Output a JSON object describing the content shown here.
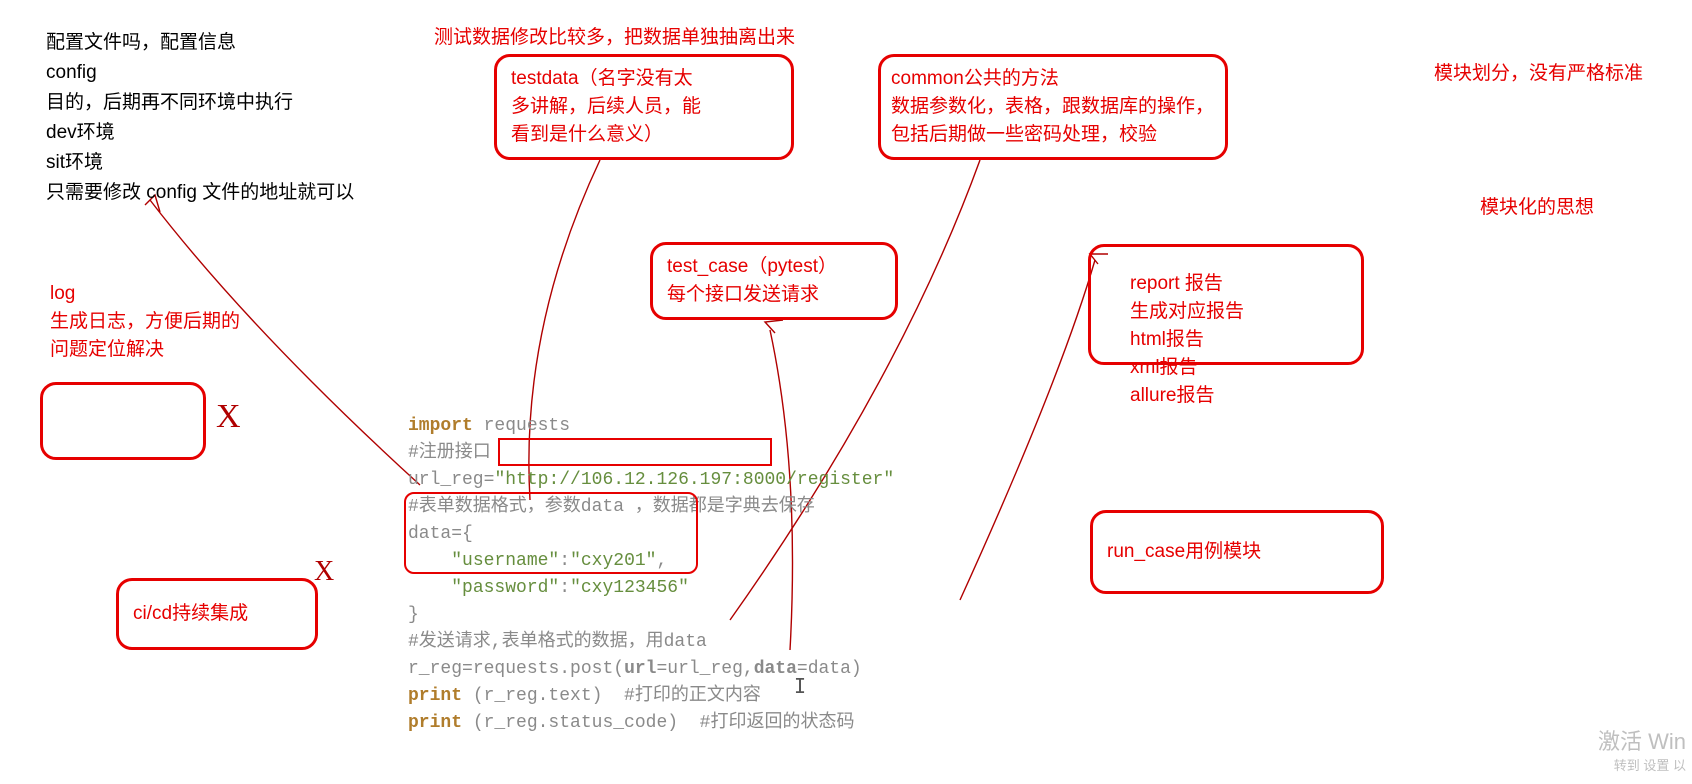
{
  "top_left_notes": "配置文件吗，配置信息\nconfig\n目的，后期再不同环境中执行\ndev环境\nsit环境\n只需要修改 config 文件的地址就可以",
  "top_red_note": "测试数据修改比较多，把数据单独抽离出来",
  "right_note_1": "模块划分，没有严格标准",
  "right_note_2": "模块化的思想",
  "box_testdata": "testdata（名字没有太\n多讲解，后续人员，能\n看到是什么意义）",
  "box_common": "common公共的方法\n数据参数化，表格，跟数据库的操作，\n包括后期做一些密码处理，校验",
  "box_testcase": "test_case（pytest）\n每个接口发送请求",
  "box_report": "report 报告\n生成对应报告\nhtml报告\nxml报告\nallure报告",
  "box_runcase": "run_case用例模块",
  "box_cicd": "ci/cd持续集成",
  "log_note": "log\n生成日志，方便后期的\n问题定位解决",
  "watermark_big": "激活 Win",
  "watermark_small": "转到 设置 以",
  "code": {
    "l1_kw": "import",
    "l1_mod": " requests",
    "l2": "#注册接口",
    "l3_id": "url_reg",
    "l3_eq": "=",
    "l3_q1": "\"",
    "l3_url": "http://106.12.126.197:8000",
    "l3_rest": "/register\"",
    "l4": "#表单数据格式，参数data ，数据都是字典去保存",
    "l5_id": "data",
    "l5_rest": "={",
    "l6_k": "\"username\"",
    "l6_c": ":",
    "l6_v": "\"cxy201\"",
    "l6_comma": ",",
    "l7_k": "\"password\"",
    "l7_c": ":",
    "l7_v": "\"cxy123456\"",
    "l8": "}",
    "l9": "#发送请求,表单格式的数据，用data",
    "l10_id": "r_reg",
    "l10_eq": "=",
    "l10_req": "requests.post(",
    "l10_p1": "url",
    "l10_p1e": "=url_reg,",
    "l10_p2": "data",
    "l10_p2e": "=data)",
    "l11_pr": "print",
    "l11_arg": " (r_reg.text)  ",
    "l11_cmt": "#打印的正文内容",
    "l12_pr": "print",
    "l12_arg": " (r_reg.status_code)  ",
    "l12_cmt": "#打印返回的状态码"
  }
}
